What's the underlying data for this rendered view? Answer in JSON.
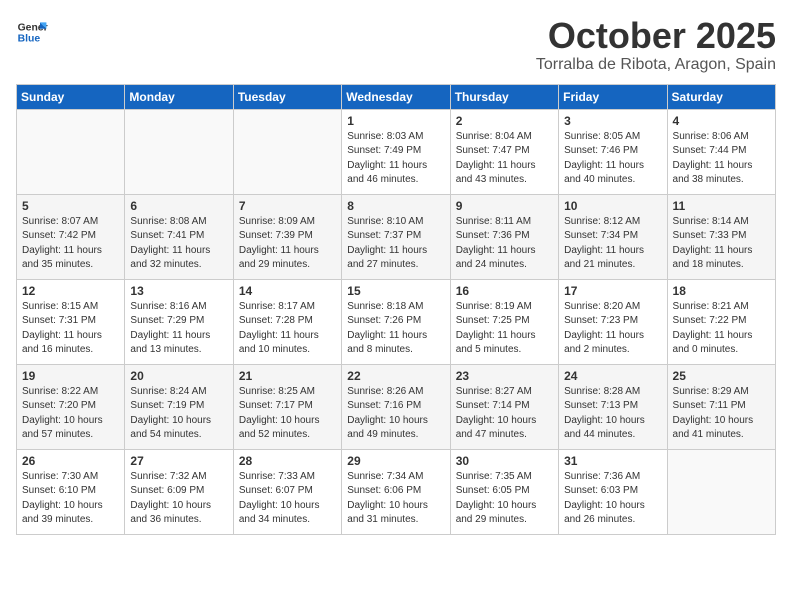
{
  "header": {
    "logo_general": "General",
    "logo_blue": "Blue",
    "month": "October 2025",
    "location": "Torralba de Ribota, Aragon, Spain"
  },
  "days_of_week": [
    "Sunday",
    "Monday",
    "Tuesday",
    "Wednesday",
    "Thursday",
    "Friday",
    "Saturday"
  ],
  "weeks": [
    [
      {
        "day": "",
        "content": ""
      },
      {
        "day": "",
        "content": ""
      },
      {
        "day": "",
        "content": ""
      },
      {
        "day": "1",
        "content": "Sunrise: 8:03 AM\nSunset: 7:49 PM\nDaylight: 11 hours\nand 46 minutes."
      },
      {
        "day": "2",
        "content": "Sunrise: 8:04 AM\nSunset: 7:47 PM\nDaylight: 11 hours\nand 43 minutes."
      },
      {
        "day": "3",
        "content": "Sunrise: 8:05 AM\nSunset: 7:46 PM\nDaylight: 11 hours\nand 40 minutes."
      },
      {
        "day": "4",
        "content": "Sunrise: 8:06 AM\nSunset: 7:44 PM\nDaylight: 11 hours\nand 38 minutes."
      }
    ],
    [
      {
        "day": "5",
        "content": "Sunrise: 8:07 AM\nSunset: 7:42 PM\nDaylight: 11 hours\nand 35 minutes."
      },
      {
        "day": "6",
        "content": "Sunrise: 8:08 AM\nSunset: 7:41 PM\nDaylight: 11 hours\nand 32 minutes."
      },
      {
        "day": "7",
        "content": "Sunrise: 8:09 AM\nSunset: 7:39 PM\nDaylight: 11 hours\nand 29 minutes."
      },
      {
        "day": "8",
        "content": "Sunrise: 8:10 AM\nSunset: 7:37 PM\nDaylight: 11 hours\nand 27 minutes."
      },
      {
        "day": "9",
        "content": "Sunrise: 8:11 AM\nSunset: 7:36 PM\nDaylight: 11 hours\nand 24 minutes."
      },
      {
        "day": "10",
        "content": "Sunrise: 8:12 AM\nSunset: 7:34 PM\nDaylight: 11 hours\nand 21 minutes."
      },
      {
        "day": "11",
        "content": "Sunrise: 8:14 AM\nSunset: 7:33 PM\nDaylight: 11 hours\nand 18 minutes."
      }
    ],
    [
      {
        "day": "12",
        "content": "Sunrise: 8:15 AM\nSunset: 7:31 PM\nDaylight: 11 hours\nand 16 minutes."
      },
      {
        "day": "13",
        "content": "Sunrise: 8:16 AM\nSunset: 7:29 PM\nDaylight: 11 hours\nand 13 minutes."
      },
      {
        "day": "14",
        "content": "Sunrise: 8:17 AM\nSunset: 7:28 PM\nDaylight: 11 hours\nand 10 minutes."
      },
      {
        "day": "15",
        "content": "Sunrise: 8:18 AM\nSunset: 7:26 PM\nDaylight: 11 hours\nand 8 minutes."
      },
      {
        "day": "16",
        "content": "Sunrise: 8:19 AM\nSunset: 7:25 PM\nDaylight: 11 hours\nand 5 minutes."
      },
      {
        "day": "17",
        "content": "Sunrise: 8:20 AM\nSunset: 7:23 PM\nDaylight: 11 hours\nand 2 minutes."
      },
      {
        "day": "18",
        "content": "Sunrise: 8:21 AM\nSunset: 7:22 PM\nDaylight: 11 hours\nand 0 minutes."
      }
    ],
    [
      {
        "day": "19",
        "content": "Sunrise: 8:22 AM\nSunset: 7:20 PM\nDaylight: 10 hours\nand 57 minutes."
      },
      {
        "day": "20",
        "content": "Sunrise: 8:24 AM\nSunset: 7:19 PM\nDaylight: 10 hours\nand 54 minutes."
      },
      {
        "day": "21",
        "content": "Sunrise: 8:25 AM\nSunset: 7:17 PM\nDaylight: 10 hours\nand 52 minutes."
      },
      {
        "day": "22",
        "content": "Sunrise: 8:26 AM\nSunset: 7:16 PM\nDaylight: 10 hours\nand 49 minutes."
      },
      {
        "day": "23",
        "content": "Sunrise: 8:27 AM\nSunset: 7:14 PM\nDaylight: 10 hours\nand 47 minutes."
      },
      {
        "day": "24",
        "content": "Sunrise: 8:28 AM\nSunset: 7:13 PM\nDaylight: 10 hours\nand 44 minutes."
      },
      {
        "day": "25",
        "content": "Sunrise: 8:29 AM\nSunset: 7:11 PM\nDaylight: 10 hours\nand 41 minutes."
      }
    ],
    [
      {
        "day": "26",
        "content": "Sunrise: 7:30 AM\nSunset: 6:10 PM\nDaylight: 10 hours\nand 39 minutes."
      },
      {
        "day": "27",
        "content": "Sunrise: 7:32 AM\nSunset: 6:09 PM\nDaylight: 10 hours\nand 36 minutes."
      },
      {
        "day": "28",
        "content": "Sunrise: 7:33 AM\nSunset: 6:07 PM\nDaylight: 10 hours\nand 34 minutes."
      },
      {
        "day": "29",
        "content": "Sunrise: 7:34 AM\nSunset: 6:06 PM\nDaylight: 10 hours\nand 31 minutes."
      },
      {
        "day": "30",
        "content": "Sunrise: 7:35 AM\nSunset: 6:05 PM\nDaylight: 10 hours\nand 29 minutes."
      },
      {
        "day": "31",
        "content": "Sunrise: 7:36 AM\nSunset: 6:03 PM\nDaylight: 10 hours\nand 26 minutes."
      },
      {
        "day": "",
        "content": ""
      }
    ]
  ]
}
